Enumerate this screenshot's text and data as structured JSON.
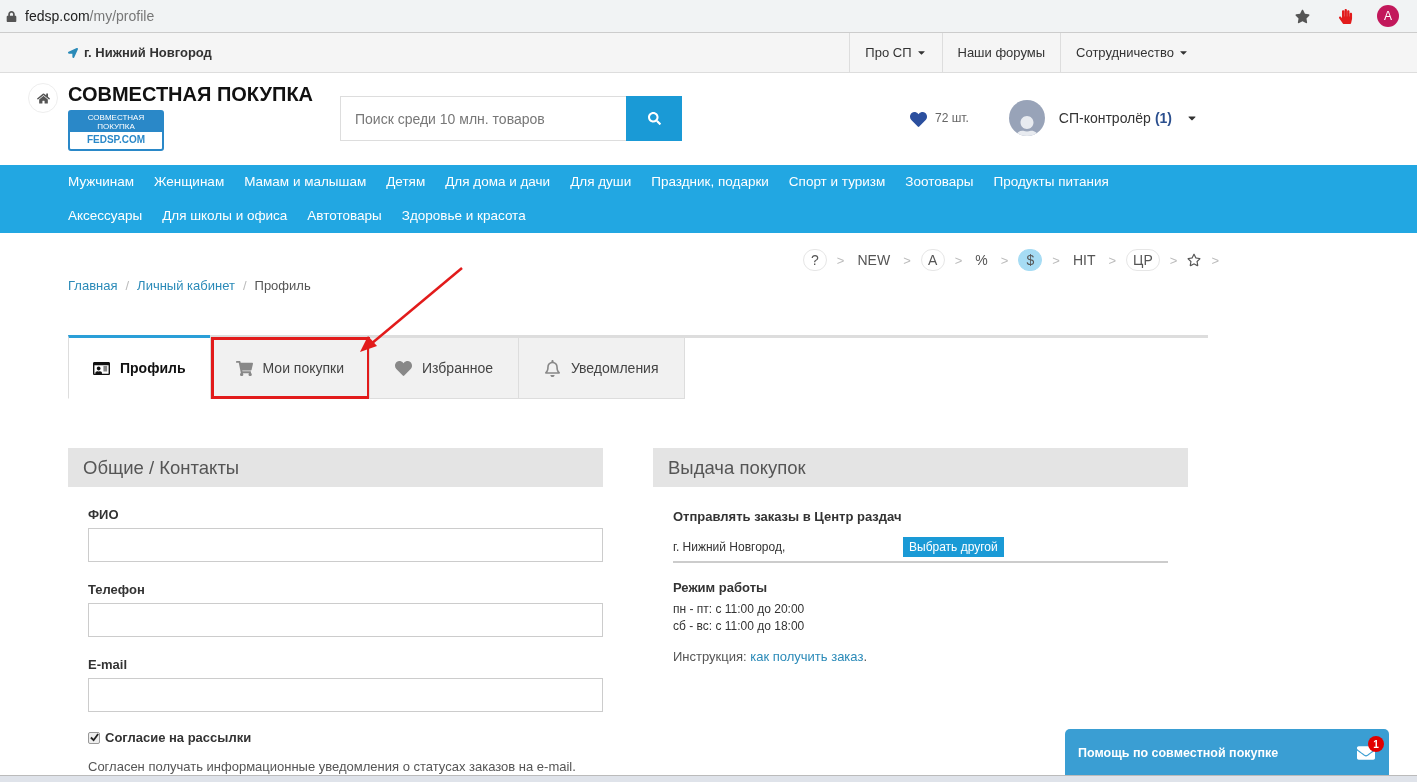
{
  "browser": {
    "url_domain": "fedsp.com",
    "url_path": "/my/profile",
    "profile_letter": "A"
  },
  "topbar": {
    "city": "г. Нижний Новгород",
    "links": [
      {
        "label": "Про СП",
        "dropdown": true
      },
      {
        "label": "Наши форумы",
        "dropdown": false
      },
      {
        "label": "Сотрудничество",
        "dropdown": true
      }
    ]
  },
  "header": {
    "title": "СОВМЕСТНАЯ ПОКУПКА",
    "logo_top": "СОВМЕСТНАЯ ПОКУПКА",
    "logo_text": "FEDSP.COM",
    "search": {
      "placeholder": "Поиск среди 10 млн. товаров"
    },
    "favorites": "72 шт.",
    "user": {
      "name": "СП-контролёр",
      "count": "(1)"
    }
  },
  "categories": [
    {
      "label": "Мужчинам"
    },
    {
      "label": "Женщинам"
    },
    {
      "label": "Мамам и малышам"
    },
    {
      "label": "Детям"
    },
    {
      "label": "Для дома и дачи"
    },
    {
      "label": "Для души"
    },
    {
      "label": "Праздник, подарки"
    },
    {
      "label": "Спорт и туризм"
    },
    {
      "label": "Зоотовары"
    },
    {
      "label": "Продукты питания"
    },
    {
      "label": "Аксессуары"
    },
    {
      "label": "Для школы и офиса"
    },
    {
      "label": "Автотовары"
    },
    {
      "label": "Здоровье и красота"
    }
  ],
  "filters": [
    {
      "kind": "circle",
      "label": "?",
      "selected": false,
      "sep": ">"
    },
    {
      "kind": "plain",
      "label": "NEW",
      "selected": false,
      "sep": ">"
    },
    {
      "kind": "circle",
      "label": "A",
      "selected": false,
      "sep": ">"
    },
    {
      "kind": "plain",
      "label": "%",
      "selected": false,
      "sep": ">"
    },
    {
      "kind": "circle",
      "label": "$",
      "selected": true,
      "sep": ">"
    },
    {
      "kind": "plain",
      "label": "HIT",
      "selected": false,
      "sep": ">"
    },
    {
      "kind": "circle",
      "label": "ЦР",
      "selected": false,
      "sep": ">"
    },
    {
      "kind": "star",
      "selected": false,
      "sep": ">"
    }
  ],
  "breadcrumbs": [
    {
      "label": "Главная",
      "link": true
    },
    {
      "label": "Личный кабинет",
      "link": true
    },
    {
      "label": "Профиль",
      "link": false
    }
  ],
  "breadcrumb_sep": "/",
  "tabs": [
    {
      "label": "Профиль",
      "selected": true,
      "highlighted": false
    },
    {
      "label": "Мои покупки",
      "selected": false,
      "highlighted": true
    },
    {
      "label": "Избранное",
      "selected": false,
      "highlighted": false
    },
    {
      "label": "Уведомления",
      "selected": false,
      "highlighted": false
    }
  ],
  "contacts": {
    "title": "Общие / Контакты",
    "fields": [
      {
        "label": "ФИО"
      },
      {
        "label": "Телефон"
      },
      {
        "label": "E-mail"
      }
    ],
    "consent": {
      "label": "Согласие на рассылки",
      "checked": true,
      "note": "Согласен получать информационные уведомления о статусах заказов на e-mail."
    }
  },
  "pickup": {
    "title": "Выдача покупок",
    "subtitle": "Отправлять заказы в Центр раздач",
    "address": "г. Нижний Новгород,",
    "change_button": "Выбрать другой",
    "hours_title": "Режим работы",
    "hours": [
      "пн - пт: с 11:00 до 20:00",
      "сб - вс: с 11:00 до 18:00"
    ],
    "instruction": {
      "prefix": "Инструкция: ",
      "link": "как получить заказ",
      "suffix": "."
    }
  },
  "help_widget": {
    "label": "Помощь по совместной покупке",
    "badge": "1"
  }
}
